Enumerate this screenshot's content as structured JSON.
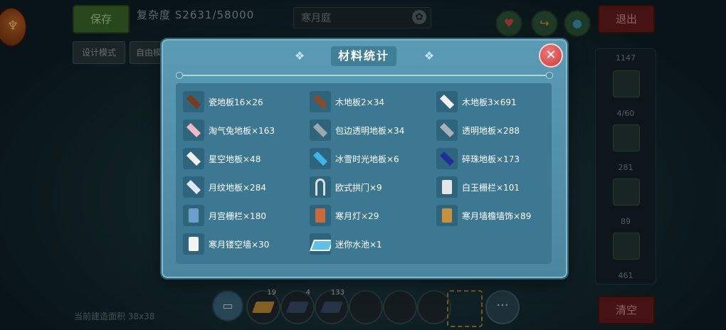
{
  "header": {
    "save_label": "保存",
    "complexity": "复杂度 S2631/58000",
    "design_mode_label": "设计模式",
    "free_label": "自由模",
    "scene_name": "寒月庭",
    "exit_label": "退出"
  },
  "footer": {
    "clear_label": "清空",
    "hint": "当前建造面积 38x38",
    "slot_counts": [
      "19",
      "4",
      "133"
    ],
    "more_label": "···"
  },
  "side_panel": {
    "counts": [
      "1147",
      "4/60",
      "281",
      "89",
      "461"
    ]
  },
  "modal": {
    "title": "材料统计",
    "close_label": "✕",
    "items": [
      {
        "label": "瓷地板16×26",
        "icon": "rug-floor-icon",
        "color": "#7a3a1c"
      },
      {
        "label": "木地板2×34",
        "icon": "wood-floor-icon",
        "color": "#8a4a2a"
      },
      {
        "label": "木地板3×691",
        "icon": "white-floor-icon",
        "color": "#f2f2f2"
      },
      {
        "label": "淘气兔地板×163",
        "icon": "pink-floor-icon",
        "color": "#f2b8c6"
      },
      {
        "label": "包边透明地板×34",
        "icon": "gray-floor-icon",
        "color": "#9aa7ad"
      },
      {
        "label": "透明地板×288",
        "icon": "gray-floor-icon",
        "color": "#a8b1b5"
      },
      {
        "label": "星空地板×48",
        "icon": "star-floor-icon",
        "color": "#eef3f6"
      },
      {
        "label": "冰雪时光地板×6",
        "icon": "ice-floor-icon",
        "color": "#3fb4e6"
      },
      {
        "label": "碎珠地板×173",
        "icon": "bead-floor-icon",
        "color": "#1e2f9a"
      },
      {
        "label": "月纹地板×284",
        "icon": "moon-floor-icon",
        "color": "#dfe8f2"
      },
      {
        "label": "欧式拱门×9",
        "icon": "arch-door-icon",
        "color": "#dcdcdc"
      },
      {
        "label": "白玉栅栏×101",
        "icon": "fence-icon",
        "color": "#e6e6e6"
      },
      {
        "label": "月宫栅栏×180",
        "icon": "gate-icon",
        "color": "#6aa0c8"
      },
      {
        "label": "寒月灯×29",
        "icon": "lamp-icon",
        "color": "#c86a3a"
      },
      {
        "label": "寒月墙檐墙饰×89",
        "icon": "eave-icon",
        "color": "#c8923a"
      },
      {
        "label": "寒月镂空墙×30",
        "icon": "hollow-wall-icon",
        "color": "#f4f4f4"
      },
      {
        "label": "迷你水池×1",
        "icon": "pool-icon",
        "color": "#5ec2e8"
      }
    ]
  }
}
